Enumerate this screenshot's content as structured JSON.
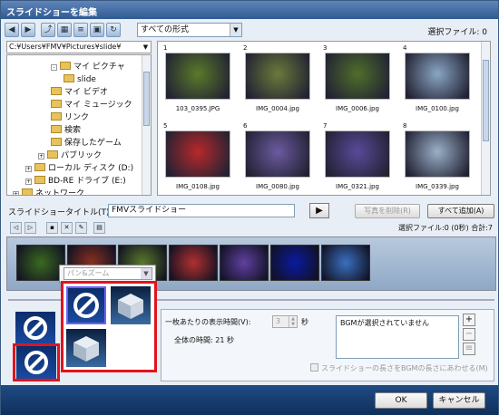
{
  "window": {
    "title": "スライドショーを編集"
  },
  "toolbar": {
    "icons": [
      "back-icon",
      "forward-icon",
      "folder-up-icon",
      "view-icon",
      "sort-icon",
      "select-icon",
      "refresh-icon"
    ],
    "filter_value": "すべての形式",
    "selected_files": "選択ファイル: 0"
  },
  "tree": {
    "path": "C:¥Users¥FMV¥Pictures¥slide¥",
    "items": [
      {
        "label": "マイ ピクチャ",
        "indent": 3,
        "expander": "-"
      },
      {
        "label": "slide",
        "indent": 4,
        "expander": ""
      },
      {
        "label": "マイ ビデオ",
        "indent": 3,
        "expander": ""
      },
      {
        "label": "マイ ミュージック",
        "indent": 3,
        "expander": ""
      },
      {
        "label": "リンク",
        "indent": 3,
        "expander": ""
      },
      {
        "label": "検索",
        "indent": 3,
        "expander": ""
      },
      {
        "label": "保存したゲーム",
        "indent": 3,
        "expander": ""
      },
      {
        "label": "パブリック",
        "indent": 2,
        "expander": "+"
      },
      {
        "label": "ローカル ディスク (D:)",
        "indent": 1,
        "expander": "+"
      },
      {
        "label": "BD-RE ドライブ (E:)",
        "indent": 1,
        "expander": "+"
      },
      {
        "label": "ネットワーク",
        "indent": 0,
        "expander": "+"
      }
    ]
  },
  "thumbnails": [
    {
      "num": "1",
      "name": "103_0395.JPG",
      "color": "#5a7a2a"
    },
    {
      "num": "2",
      "name": "IMG_0004.jpg",
      "color": "#6b7a3a"
    },
    {
      "num": "3",
      "name": "IMG_0006.jpg",
      "color": "#4f6e2a"
    },
    {
      "num": "4",
      "name": "IMG_0100.jpg",
      "color": "#8aa6c4"
    },
    {
      "num": "5",
      "name": "IMG_0108.jpg",
      "color": "#b8282a"
    },
    {
      "num": "6",
      "name": "IMG_0080.jpg",
      "color": "#6c5aa0"
    },
    {
      "num": "7",
      "name": "IMG_0321.jpg",
      "color": "#5a4a9a"
    },
    {
      "num": "8",
      "name": "IMG_0339.jpg",
      "color": "#9ab0c8"
    }
  ],
  "slideshow": {
    "title_label": "スライドショータイトル(T):",
    "title_value": "FMVスライドショー",
    "remove_button": "写真を削除(R)",
    "add_all_button": "すべて追加(A)",
    "count_line": "選択ファイル:0 (0秒) 合計:7",
    "strip_colors": [
      "#3a6a20",
      "#8a3020",
      "#5a7a2a",
      "#b03030",
      "#6040a0",
      "#0a1aa0",
      "#3a70c0"
    ]
  },
  "transition": {
    "select_value": "パン&ズーム"
  },
  "settings": {
    "per_slide_label": "一枚あたりの表示時間(V):",
    "seconds_value": "3",
    "seconds_unit": "秒",
    "total_time": "全体の時間: 21 秒",
    "bgm_text": "BGMが選択されていません",
    "fit_checkbox_label": "スライドショーの長さをBGMの長さにあわせる(M)"
  },
  "footer": {
    "ok": "OK",
    "cancel": "キャンセル"
  }
}
